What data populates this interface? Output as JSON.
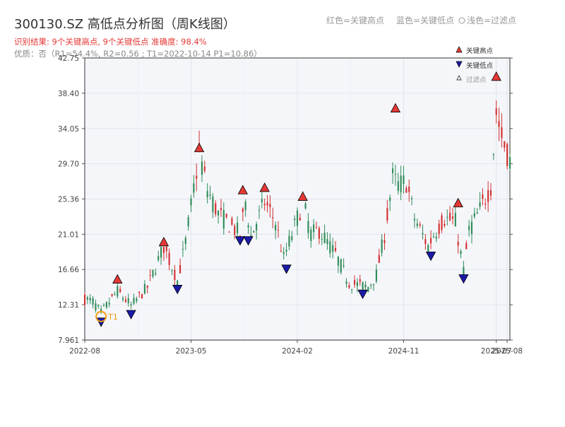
{
  "title": "300130.SZ 高低点分析图（周K线图）",
  "subtitle_line1": "识别结果: 9个关键高点, 9个关键低点  准确度: 98.4%",
  "subtitle_line2": "优质：否（R1=54.4%, R2=0.56 ; T1=2022-10-14 P1=10.86）",
  "header_legend": [
    "红色=关键高点",
    "蓝色=关键低点",
    "浅色=过滤点"
  ],
  "legend": [
    {
      "label": "关键高点",
      "marker": "triangle-up",
      "color": "#e53935"
    },
    {
      "label": "关键低点",
      "marker": "triangle-down",
      "color": "#1a1aa8"
    },
    {
      "label": "过滤点",
      "marker": "triangle-up-small",
      "color": "#ffffff"
    }
  ],
  "t1_label": "T1",
  "colors": {
    "up": "#d32f2f",
    "down": "#2e8b57",
    "high_marker": "#e53935",
    "low_marker": "#1a1aa8",
    "t1_circle": "#f39c12",
    "subtitle1": "#e53935",
    "subtitle2": "#888888",
    "title": "#333333",
    "plot_bg": "#f4f6fa"
  },
  "chart_data": {
    "type": "candlestick",
    "x_tick_labels": [
      "2022-08",
      "2023-05",
      "2024-02",
      "2024-11",
      "2025-07",
      "2025-08"
    ],
    "x_tick_weeks": [
      0,
      39,
      78,
      117,
      151,
      155
    ],
    "x_range_weeks": [
      0,
      156
    ],
    "y_tick_labels": [
      "7.961",
      "12.31",
      "16.66",
      "21.01",
      "25.36",
      "29.70",
      "34.05",
      "38.40",
      "42.75"
    ],
    "y_ticks": [
      7.961,
      12.31,
      16.66,
      21.01,
      25.36,
      29.7,
      34.05,
      38.4,
      42.75
    ],
    "ylim": [
      7.961,
      42.75
    ],
    "grid": true,
    "anchors": [
      [
        0,
        13.0
      ],
      [
        3,
        12.7
      ],
      [
        6,
        11.3
      ],
      [
        12,
        14.0
      ],
      [
        17,
        12.2
      ],
      [
        23,
        14.5
      ],
      [
        29,
        19.5
      ],
      [
        34,
        15.3
      ],
      [
        37,
        20.0
      ],
      [
        42,
        31.0
      ],
      [
        45,
        26.5
      ],
      [
        49,
        23.5
      ],
      [
        57,
        21.0
      ],
      [
        59,
        25.0
      ],
      [
        61,
        20.8
      ],
      [
        66,
        25.0
      ],
      [
        70,
        22.5
      ],
      [
        73,
        18.0
      ],
      [
        76,
        21.0
      ],
      [
        80,
        25.0
      ],
      [
        83,
        21.0
      ],
      [
        86,
        21.5
      ],
      [
        92,
        18.5
      ],
      [
        97,
        15.0
      ],
      [
        104,
        14.5
      ],
      [
        107,
        16.0
      ],
      [
        110,
        21.0
      ],
      [
        113,
        28.0
      ],
      [
        115,
        27.0
      ],
      [
        118,
        27.5
      ],
      [
        121,
        23.0
      ],
      [
        126,
        19.5
      ],
      [
        128,
        21.0
      ],
      [
        132,
        23.0
      ],
      [
        136,
        22.5
      ],
      [
        139,
        16.5
      ],
      [
        141,
        21.5
      ],
      [
        145,
        24.0
      ],
      [
        149,
        27.0
      ],
      [
        151,
        36.0
      ],
      [
        153,
        33.0
      ],
      [
        156,
        30.0
      ]
    ],
    "key_highs": [
      {
        "week": 12,
        "price": 14.8
      },
      {
        "week": 29,
        "price": 19.4
      },
      {
        "week": 42,
        "price": 31.0
      },
      {
        "week": 58,
        "price": 25.8
      },
      {
        "week": 66,
        "price": 26.1
      },
      {
        "week": 80,
        "price": 25.0
      },
      {
        "week": 114,
        "price": 35.9
      },
      {
        "week": 137,
        "price": 24.2
      },
      {
        "week": 151,
        "price": 39.8
      }
    ],
    "key_lows": [
      {
        "week": 6,
        "price": 10.86
      },
      {
        "week": 17,
        "price": 11.8
      },
      {
        "week": 34,
        "price": 14.9
      },
      {
        "week": 57,
        "price": 20.9
      },
      {
        "week": 60,
        "price": 20.9
      },
      {
        "week": 74,
        "price": 17.4
      },
      {
        "week": 102,
        "price": 14.3
      },
      {
        "week": 127,
        "price": 19.0
      },
      {
        "week": 139,
        "price": 16.2
      }
    ],
    "t1": {
      "week": 6,
      "price": 10.86,
      "date": "2022-10-14"
    }
  }
}
